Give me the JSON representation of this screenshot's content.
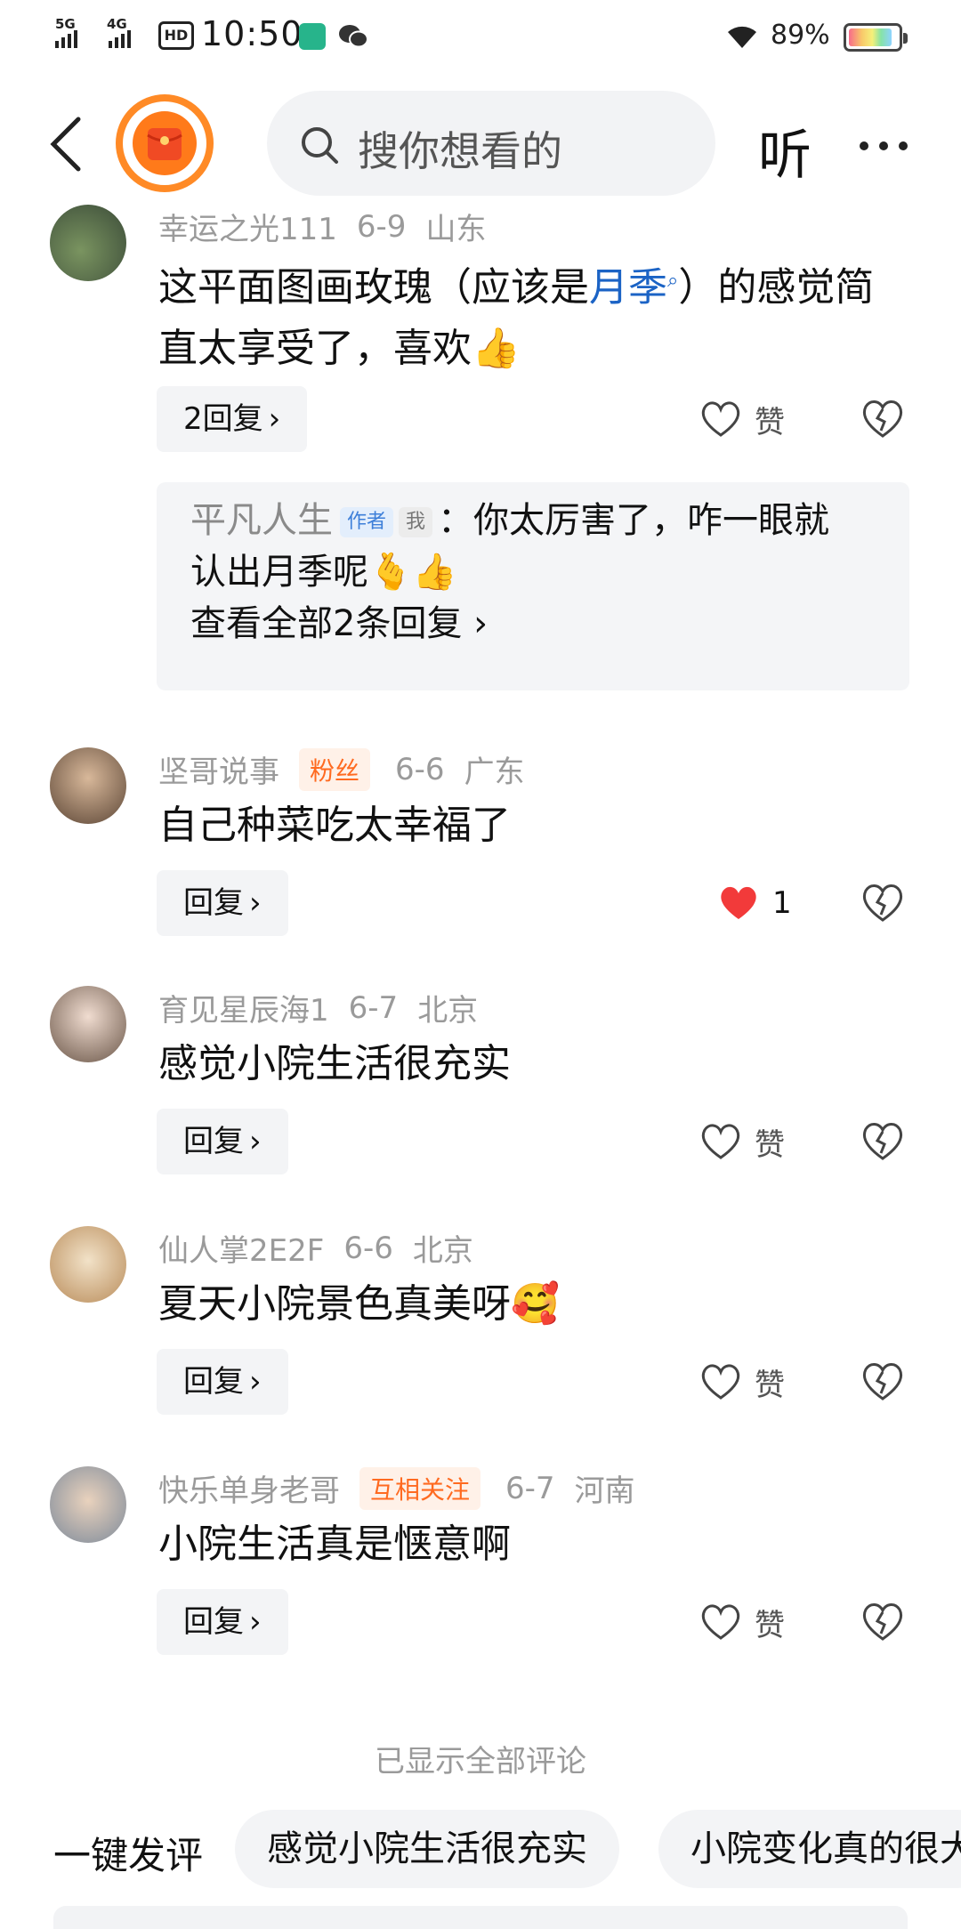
{
  "status_bar": {
    "net1": "5G",
    "net2": "4G",
    "hd": "HD",
    "time": "10:50",
    "battery": "89%",
    "battery_level": 0.89
  },
  "nav": {
    "search_placeholder": "搜你想看的",
    "listen": "听"
  },
  "comments": [
    {
      "user": "幸运之光111",
      "date": "6-9",
      "location": "山东",
      "text_before": "这平面图画玫瑰（应该是",
      "link": "月季",
      "text_after": "）的感觉简直太享受了，喜欢",
      "reply_label": "2回复",
      "like_label": "赞",
      "sub_reply": {
        "author": "平凡人生",
        "badge_author": "作者",
        "badge_me": "我",
        "text_line1": "：你太厉害了，咋一眼就",
        "text_line2": "认出月季呢",
        "view_all": "查看全部2条回复"
      }
    },
    {
      "user": "坚哥说事",
      "tag": "粉丝",
      "date": "6-6",
      "location": "广东",
      "text": "自己种菜吃太幸福了",
      "reply_label": "回复",
      "like_count": "1",
      "liked": true
    },
    {
      "user": "育见星辰海1",
      "date": "6-7",
      "location": "北京",
      "text": "感觉小院生活很充实",
      "reply_label": "回复",
      "like_label": "赞"
    },
    {
      "user": "仙人掌2E2F",
      "date": "6-6",
      "location": "北京",
      "text": "夏天小院景色真美呀",
      "reply_label": "回复",
      "like_label": "赞"
    },
    {
      "user": "快乐单身老哥",
      "tag": "互相关注",
      "date": "6-7",
      "location": "河南",
      "text": "小院生活真是惬意啊",
      "reply_label": "回复",
      "like_label": "赞"
    }
  ],
  "all_shown": "已显示全部评论",
  "quick_comment": {
    "label": "一键发评",
    "chips": [
      "感觉小院生活很充实",
      "小院变化真的很大"
    ]
  },
  "colors": {
    "accent_orange": "#ff8a26",
    "link_blue": "#1b63c5",
    "like_red": "#f23a3a"
  }
}
